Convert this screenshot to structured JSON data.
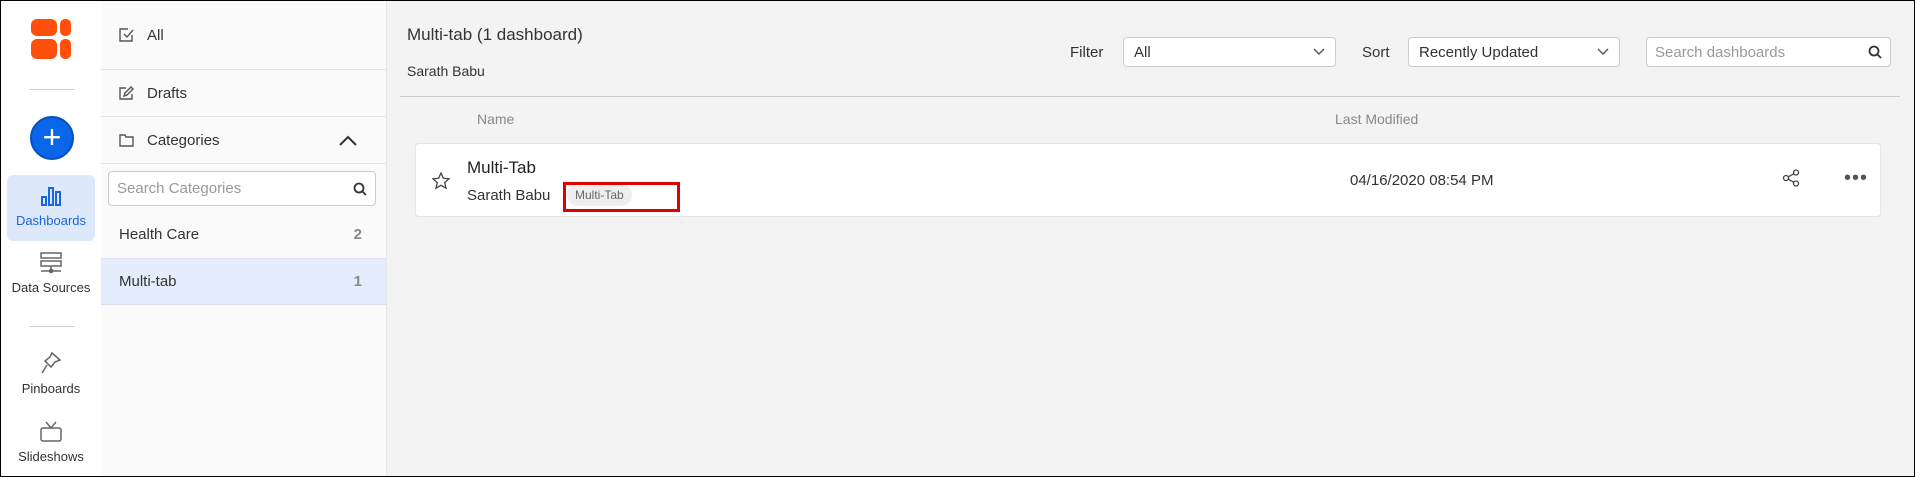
{
  "nav": {
    "items": [
      {
        "label": "Dashboards"
      },
      {
        "label": "Data Sources"
      },
      {
        "label": "Pinboards"
      },
      {
        "label": "Slideshows"
      }
    ]
  },
  "categories_panel": {
    "all_label": "All",
    "drafts_label": "Drafts",
    "categories_label": "Categories",
    "search_placeholder": "Search Categories",
    "items": [
      {
        "name": "Health Care",
        "count": "2"
      },
      {
        "name": "Multi-tab",
        "count": "1"
      }
    ]
  },
  "main": {
    "title": "Multi-tab (1 dashboard)",
    "subtitle": "Sarath Babu",
    "filter_label": "Filter",
    "filter_value": "All",
    "sort_label": "Sort",
    "sort_value": "Recently Updated",
    "search_placeholder": "Search dashboards",
    "columns": {
      "name": "Name",
      "last_modified": "Last Modified"
    },
    "rows": [
      {
        "title": "Multi-Tab",
        "owner": "Sarath Babu",
        "tag": "Multi-Tab",
        "last_modified": "04/16/2020 08:54 PM"
      }
    ]
  },
  "colors": {
    "accent": "#0a66e8",
    "logo": "#ff4f0a",
    "highlight": "#e00000"
  }
}
